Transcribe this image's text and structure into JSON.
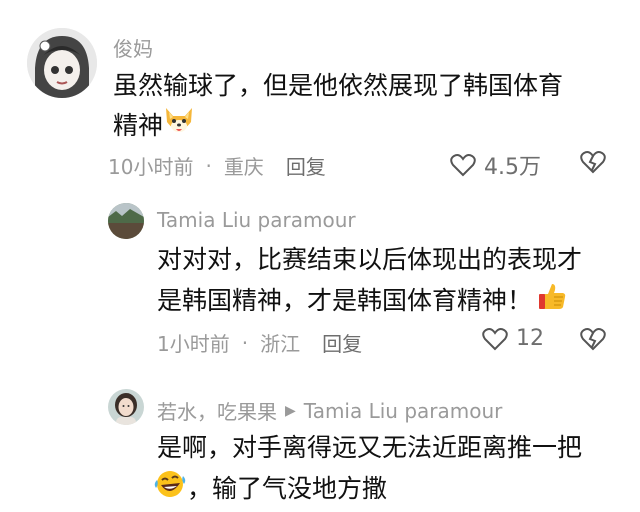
{
  "comments": [
    {
      "username": "俊妈",
      "text_line1": "虽然输球了，但是他依然展现了韩国体育",
      "text_line2": "精神",
      "time": "10小时前",
      "dot": "·",
      "location": "重庆",
      "reply_label": "回复",
      "like_count": "4.5万",
      "trailing_emoji": "fox-face-emoji",
      "avatar": "anime-girl-avatar"
    },
    {
      "username": "Tamia Liu paramour",
      "text_line1": "对对对，比赛结束以后体现出的表现才",
      "text_line2": "是韩国精神，才是韩国体育精神！",
      "time": "1小时前",
      "dot": "·",
      "location": "浙江",
      "reply_label": "回复",
      "like_count": "12",
      "trailing_emoji": "thumbs-up-emoji",
      "avatar": "landscape-avatar"
    },
    {
      "username": "若水，吃果果",
      "reply_arrow": "▶",
      "reply_to": "Tamia Liu paramour",
      "text_line1": "是啊，对手离得远又无法近距离推一把",
      "text_line2": "，输了气没地方撒",
      "leading_emoji": "laughing-tears-emoji",
      "avatar": "woman-avatar"
    }
  ],
  "colors": {
    "meta_gray": "#9a9a9a",
    "reply_gray": "#6e6e6e",
    "text_black": "#111111"
  }
}
